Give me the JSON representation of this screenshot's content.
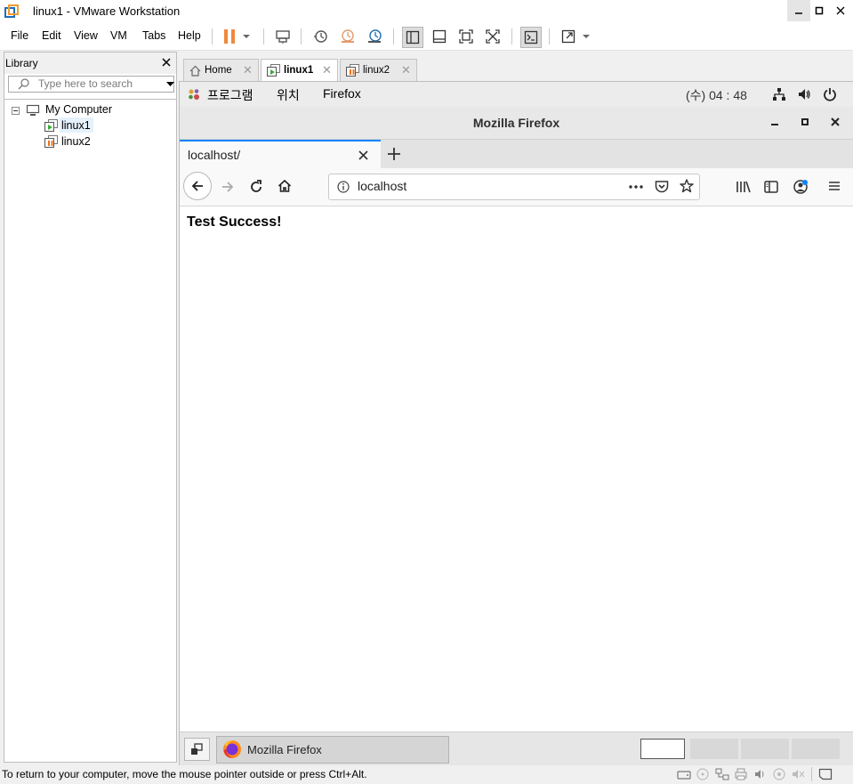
{
  "window": {
    "title": "linux1 - VMware Workstation"
  },
  "menu": {
    "items": [
      "File",
      "Edit",
      "View",
      "VM",
      "Tabs",
      "Help"
    ]
  },
  "library": {
    "title": "Library",
    "search_placeholder": "Type here to search",
    "tree": {
      "root": "My Computer",
      "vms": [
        "linux1",
        "linux2"
      ]
    }
  },
  "tabs": [
    {
      "label": "Home"
    },
    {
      "label": "linux1"
    },
    {
      "label": "linux2"
    }
  ],
  "guest": {
    "topbar": {
      "apps": "프로그램",
      "places": "위치",
      "app_name": "Firefox",
      "clock": "(수) 04 : 48"
    },
    "firefox": {
      "window_title": "Mozilla Firefox",
      "tab_title": "localhost/",
      "url": "localhost",
      "page_text": "Test Success!"
    },
    "taskbar": {
      "window_item": "Mozilla Firefox"
    }
  },
  "statusbar": {
    "message": "To return to your computer, move the mouse pointer outside or press Ctrl+Alt."
  },
  "colors": {
    "accent_tab": "#0a84ff",
    "pause_orange": "#f0883e",
    "vm_running_green": "#3aaa35",
    "vm_suspended_orange": "#e8741c"
  }
}
